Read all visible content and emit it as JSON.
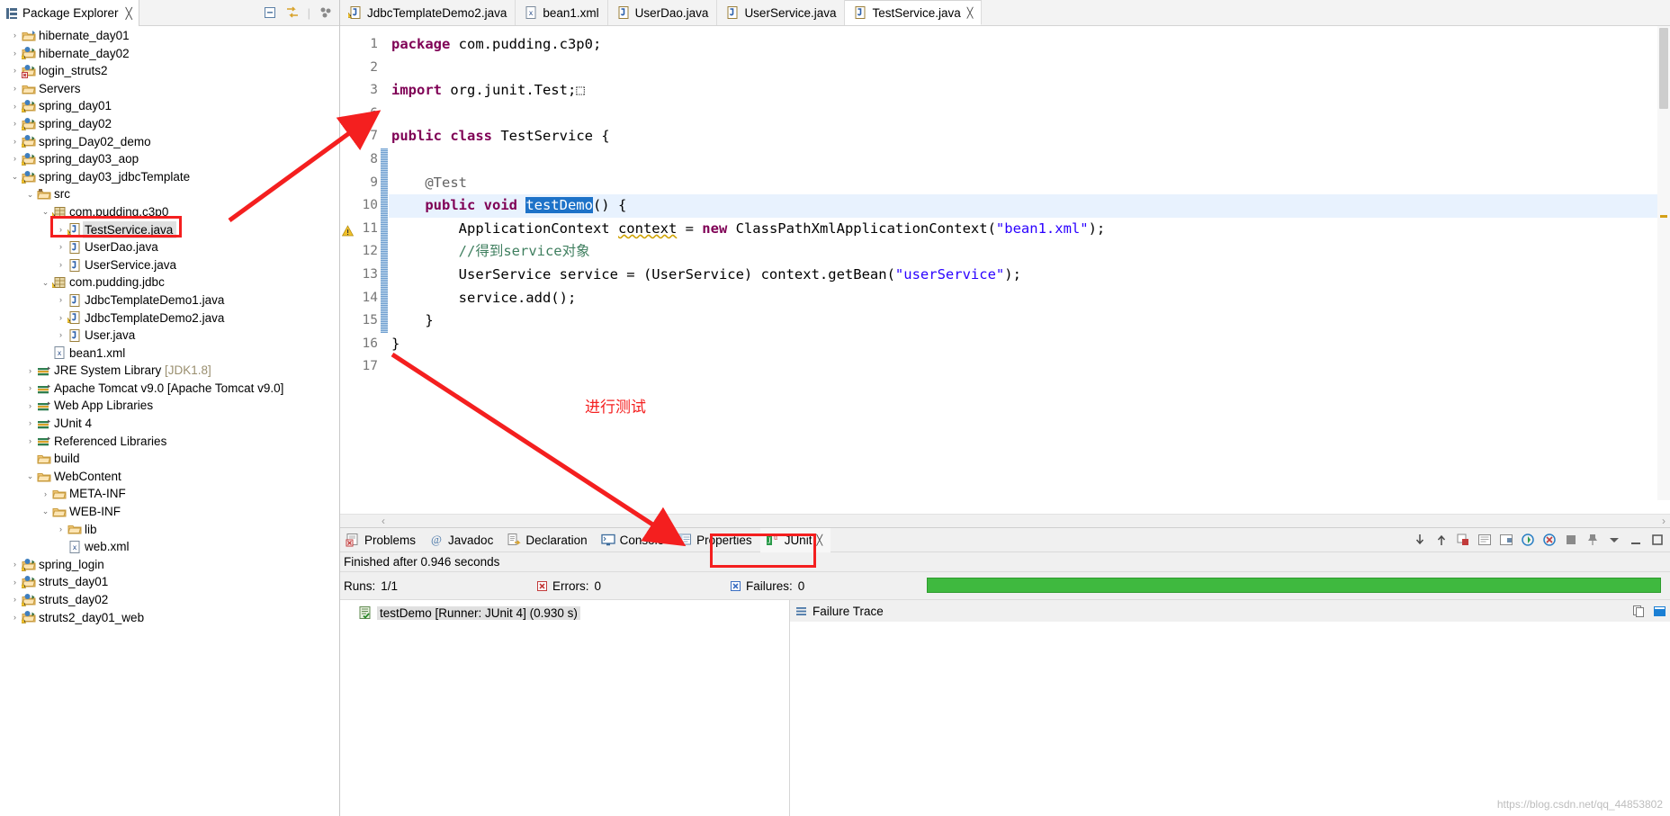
{
  "package_explorer": {
    "tab_title": "Package Explorer",
    "close_label": "╳",
    "toolbar": [
      "collapse-all-icon",
      "link-with-editor-icon",
      "view-menu-icon"
    ],
    "tree": [
      {
        "indent": 0,
        "arrow": "›",
        "icon": "project-folder",
        "label": "hibernate_day01"
      },
      {
        "indent": 0,
        "arrow": "›",
        "icon": "project-warn",
        "label": "hibernate_day02"
      },
      {
        "indent": 0,
        "arrow": "›",
        "icon": "project-error",
        "label": "login_struts2"
      },
      {
        "indent": 0,
        "arrow": "›",
        "icon": "folder",
        "label": "Servers"
      },
      {
        "indent": 0,
        "arrow": "›",
        "icon": "project-warn",
        "label": "spring_day01"
      },
      {
        "indent": 0,
        "arrow": "›",
        "icon": "project-warn",
        "label": "spring_day02"
      },
      {
        "indent": 0,
        "arrow": "›",
        "icon": "project-warn",
        "label": "spring_Day02_demo"
      },
      {
        "indent": 0,
        "arrow": "›",
        "icon": "project-warn",
        "label": "spring_day03_aop"
      },
      {
        "indent": 0,
        "arrow": "⌄",
        "icon": "project-warn",
        "label": "spring_day03_jdbcTemplate"
      },
      {
        "indent": 1,
        "arrow": "⌄",
        "icon": "src-folder",
        "label": "src"
      },
      {
        "indent": 2,
        "arrow": "⌄",
        "icon": "package-warn",
        "label": "com.pudding.c3p0"
      },
      {
        "indent": 3,
        "arrow": "›",
        "icon": "java-warn",
        "label": "TestService.java",
        "selected": true
      },
      {
        "indent": 3,
        "arrow": "›",
        "icon": "java",
        "label": "UserDao.java"
      },
      {
        "indent": 3,
        "arrow": "›",
        "icon": "java",
        "label": "UserService.java"
      },
      {
        "indent": 2,
        "arrow": "⌄",
        "icon": "package-warn",
        "label": "com.pudding.jdbc"
      },
      {
        "indent": 3,
        "arrow": "›",
        "icon": "java",
        "label": "JdbcTemplateDemo1.java"
      },
      {
        "indent": 3,
        "arrow": "›",
        "icon": "java-warn",
        "label": "JdbcTemplateDemo2.java"
      },
      {
        "indent": 3,
        "arrow": "›",
        "icon": "java",
        "label": "User.java"
      },
      {
        "indent": 2,
        "arrow": "",
        "icon": "xml",
        "label": "bean1.xml"
      },
      {
        "indent": 1,
        "arrow": "›",
        "icon": "library",
        "label": "JRE System Library ",
        "sub": "[JDK1.8]"
      },
      {
        "indent": 1,
        "arrow": "›",
        "icon": "library",
        "label": "Apache Tomcat v9.0 [Apache Tomcat v9.0]"
      },
      {
        "indent": 1,
        "arrow": "›",
        "icon": "library",
        "label": "Web App Libraries"
      },
      {
        "indent": 1,
        "arrow": "›",
        "icon": "library",
        "label": "JUnit 4"
      },
      {
        "indent": 1,
        "arrow": "›",
        "icon": "library",
        "label": "Referenced Libraries"
      },
      {
        "indent": 1,
        "arrow": "",
        "icon": "folder",
        "label": "build"
      },
      {
        "indent": 1,
        "arrow": "⌄",
        "icon": "folder",
        "label": "WebContent"
      },
      {
        "indent": 2,
        "arrow": "›",
        "icon": "folder",
        "label": "META-INF"
      },
      {
        "indent": 2,
        "arrow": "⌄",
        "icon": "folder",
        "label": "WEB-INF"
      },
      {
        "indent": 3,
        "arrow": "›",
        "icon": "folder",
        "label": "lib"
      },
      {
        "indent": 3,
        "arrow": "",
        "icon": "xml",
        "label": "web.xml"
      },
      {
        "indent": 0,
        "arrow": "›",
        "icon": "project-warn",
        "label": "spring_login"
      },
      {
        "indent": 0,
        "arrow": "›",
        "icon": "project-warn",
        "label": "struts_day01"
      },
      {
        "indent": 0,
        "arrow": "›",
        "icon": "project-warn",
        "label": "struts_day02"
      },
      {
        "indent": 0,
        "arrow": "›",
        "icon": "project-warn",
        "label": "struts2_day01_web"
      }
    ]
  },
  "editor": {
    "tabs": [
      {
        "label": "JdbcTemplateDemo2.java",
        "icon": "java-warn",
        "active": false,
        "closable": false
      },
      {
        "label": "bean1.xml",
        "icon": "xml",
        "active": false,
        "closable": false
      },
      {
        "label": "UserDao.java",
        "icon": "java",
        "active": false,
        "closable": false
      },
      {
        "label": "UserService.java",
        "icon": "java",
        "active": false,
        "closable": false
      },
      {
        "label": "TestService.java",
        "icon": "java",
        "active": true,
        "closable": true,
        "close_label": "╳"
      }
    ],
    "lines": [
      {
        "num": "1",
        "fold": "",
        "warn": false,
        "hl": false,
        "ann": false,
        "tokens": [
          {
            "t": "package ",
            "c": "kw"
          },
          {
            "t": "com.pudding.c3p0;",
            "c": "plain"
          }
        ]
      },
      {
        "num": "2",
        "fold": "",
        "warn": false,
        "hl": false,
        "ann": false,
        "tokens": []
      },
      {
        "num": "3",
        "fold": "⊕",
        "warn": false,
        "hl": false,
        "ann": false,
        "tokens": [
          {
            "t": "import ",
            "c": "kw"
          },
          {
            "t": "org.junit.Test;",
            "c": "plain"
          },
          {
            "t": "⬚",
            "c": "fold-box"
          }
        ]
      },
      {
        "num": "6",
        "fold": "",
        "warn": false,
        "hl": false,
        "ann": false,
        "tokens": []
      },
      {
        "num": "7",
        "fold": "",
        "warn": false,
        "hl": false,
        "ann": false,
        "tokens": [
          {
            "t": "public class ",
            "c": "kw"
          },
          {
            "t": "TestService {",
            "c": "plain"
          }
        ]
      },
      {
        "num": "8",
        "fold": "",
        "warn": false,
        "hl": false,
        "ann": true,
        "tokens": []
      },
      {
        "num": "9",
        "fold": "⊖",
        "warn": false,
        "hl": false,
        "ann": true,
        "tokens": [
          {
            "t": "    ",
            "c": "plain"
          },
          {
            "t": "@Test",
            "c": "ann"
          }
        ]
      },
      {
        "num": "10",
        "fold": "",
        "warn": false,
        "hl": true,
        "ann": true,
        "tokens": [
          {
            "t": "    ",
            "c": "plain"
          },
          {
            "t": "public void ",
            "c": "kw"
          },
          {
            "t": "testDemo",
            "c": "sel"
          },
          {
            "t": "() {",
            "c": "plain"
          }
        ]
      },
      {
        "num": "11",
        "fold": "",
        "warn": true,
        "hl": false,
        "ann": true,
        "tokens": [
          {
            "t": "        ApplicationContext ",
            "c": "plain"
          },
          {
            "t": "context",
            "c": "und"
          },
          {
            "t": " = ",
            "c": "plain"
          },
          {
            "t": "new ",
            "c": "kw"
          },
          {
            "t": "ClassPathXmlApplicationContext(",
            "c": "plain"
          },
          {
            "t": "\"bean1.xml\"",
            "c": "str"
          },
          {
            "t": ");",
            "c": "plain"
          }
        ]
      },
      {
        "num": "12",
        "fold": "",
        "warn": false,
        "hl": false,
        "ann": true,
        "tokens": [
          {
            "t": "        //得到service对象",
            "c": "cmt"
          }
        ]
      },
      {
        "num": "13",
        "fold": "",
        "warn": false,
        "hl": false,
        "ann": true,
        "tokens": [
          {
            "t": "        UserService service = (UserService) context.getBean(",
            "c": "plain"
          },
          {
            "t": "\"userService\"",
            "c": "str"
          },
          {
            "t": ");",
            "c": "plain"
          }
        ]
      },
      {
        "num": "14",
        "fold": "",
        "warn": false,
        "hl": false,
        "ann": true,
        "tokens": [
          {
            "t": "        service.add();",
            "c": "plain"
          }
        ]
      },
      {
        "num": "15",
        "fold": "",
        "warn": false,
        "hl": false,
        "ann": true,
        "tokens": [
          {
            "t": "    }",
            "c": "plain"
          }
        ]
      },
      {
        "num": "16",
        "fold": "",
        "warn": false,
        "hl": false,
        "ann": false,
        "tokens": [
          {
            "t": "}",
            "c": "plain"
          }
        ]
      },
      {
        "num": "17",
        "fold": "",
        "warn": false,
        "hl": false,
        "ann": false,
        "tokens": []
      }
    ],
    "hscroll_left": "‹",
    "hscroll_right": "›"
  },
  "bottom_panel": {
    "tabs": [
      {
        "label": "Problems",
        "icon": "problems-icon",
        "active": false
      },
      {
        "label": "Javadoc",
        "icon": "javadoc-icon",
        "active": false
      },
      {
        "label": "Declaration",
        "icon": "declaration-icon",
        "active": false
      },
      {
        "label": "Console",
        "icon": "console-icon",
        "active": false
      },
      {
        "label": "Properties",
        "icon": "properties-icon",
        "active": false
      },
      {
        "label": "JUnit",
        "icon": "junit-icon",
        "active": true,
        "close_label": "╳"
      }
    ],
    "toolbar": [
      "next-failure-icon",
      "prev-failure-icon",
      "show-failures-only-icon",
      "history-icon",
      "scroll-lock-icon",
      "rerun-icon",
      "rerun-failed-icon",
      "stop-icon",
      "pin-icon",
      "view-menu-icon",
      "minimize-icon",
      "maximize-icon"
    ]
  },
  "junit": {
    "status": "Finished after 0.946 seconds",
    "runs_label": "Runs:",
    "runs_value": "1/1",
    "errors_label": "Errors:",
    "errors_value": "0",
    "failures_label": "Failures:",
    "failures_value": "0",
    "progress_color": "#3fb93f",
    "tree": [
      {
        "icon": "test-pass-icon",
        "label": "testDemo [Runner: JUnit 4] (0.930 s)",
        "selected": true
      }
    ],
    "failure_trace_label": "Failure Trace",
    "watermark": "https://blog.csdn.net/qq_44853802"
  },
  "annotations": {
    "callout_text": "进行测试",
    "callout_color": "#f41f1f",
    "highlight_boxes": [
      "tree-testservice-java",
      "junit-tab"
    ]
  }
}
